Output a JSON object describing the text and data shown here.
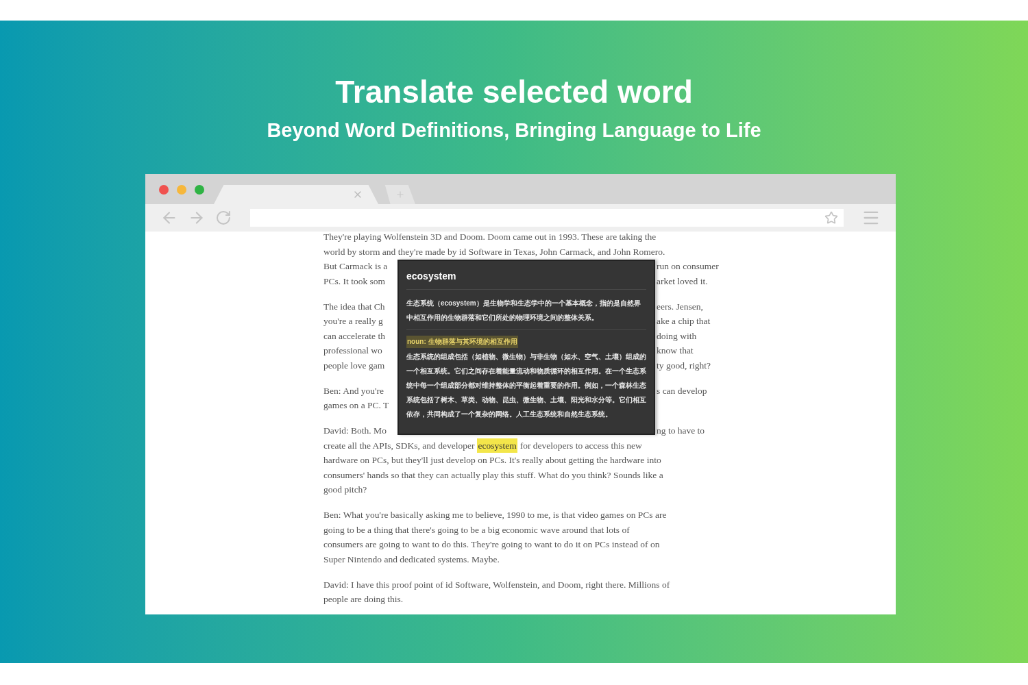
{
  "banner": {
    "title": "Translate selected word",
    "subtitle": "Beyond Word Definitions, Bringing Language to Life"
  },
  "article": {
    "paragraphs": [
      {
        "lines": [
          {
            "kind": "full",
            "text": "They're playing Wolfenstein 3D and Doom. Doom came out in 1993. These are taking the"
          },
          {
            "kind": "full",
            "text": "world by storm and they're made by id Software in Texas, John Carmack, and John Romero."
          },
          {
            "kind": "split",
            "left": "But Carmack is a",
            "right": "run on consumer"
          },
          {
            "kind": "split",
            "left": "PCs. It took som",
            "right": "arket loved it."
          }
        ]
      },
      {
        "lines": [
          {
            "kind": "split",
            "left": "The idea that Ch",
            "right": "eers. Jensen,"
          },
          {
            "kind": "split",
            "left": "you're a really g",
            "right": "ake a chip that"
          },
          {
            "kind": "split",
            "left": "can accelerate th",
            "right": "doing with"
          },
          {
            "kind": "split",
            "left": "professional wo",
            "right": "know that"
          },
          {
            "kind": "split",
            "left": "people love gam",
            "right": "ty good, right?"
          }
        ]
      },
      {
        "lines": [
          {
            "kind": "split",
            "left": "Ben: And you're",
            "right": "s can develop"
          },
          {
            "kind": "split",
            "left": "games on a PC. T"
          }
        ]
      },
      {
        "lines": [
          {
            "kind": "split",
            "left": "David: Both. Mo",
            "right": "ng to have to"
          },
          {
            "kind": "highlight",
            "before": "create all the APIs, SDKs, and developer",
            "word": "ecosystem",
            "after": "for developers to access this new"
          },
          {
            "kind": "full",
            "text": "hardware on PCs, but they'll just develop on PCs. It's really about getting the hardware into"
          },
          {
            "kind": "full",
            "text": "consumers' hands so that they can actually play this stuff. What do you think? Sounds like a"
          },
          {
            "kind": "full",
            "text": "good pitch?"
          }
        ]
      },
      {
        "lines": [
          {
            "kind": "full",
            "text": "Ben: What you're basically asking me to believe, 1990 to me, is that video games on PCs are"
          },
          {
            "kind": "full",
            "text": "going to be a thing that there's going to be a big economic wave around that lots of"
          },
          {
            "kind": "full",
            "text": "consumers are going to want to do this. They're going to want to do it on PCs instead of on"
          },
          {
            "kind": "full",
            "text": "Super Nintendo and dedicated systems. Maybe."
          }
        ]
      },
      {
        "lines": [
          {
            "kind": "full",
            "text": "David: I have this proof point of id Software, Wolfenstein, and Doom, right there. Millions of"
          },
          {
            "kind": "full",
            "text": "people are doing this."
          }
        ]
      }
    ]
  },
  "popup": {
    "word": "ecosystem",
    "summary": "生态系统（ecosystem）是生物学和生态学中的一个基本概念，指的是自然界中相互作用的生物群落和它们所处的物理环境之间的整体关系。",
    "sense": {
      "pos": "noun:",
      "gloss": "生物群落与其环境的相互作用"
    },
    "definition": "生态系统的组成包括（如植物、微生物）与非生物（如水、空气、土壤）组成的一个相互系统。它们之间存在着能量流动和物质循环的相互作用。在一个生态系统中每一个组成部分都对维持整体的平衡起着重要的作用。例如，一个森林生态系统包括了树木、草类、动物、昆虫、微生物、土壤、阳光和水分等。它们相互依存，共同构成了一个复杂的网络。人工生态系统和自然生态系统。"
  }
}
